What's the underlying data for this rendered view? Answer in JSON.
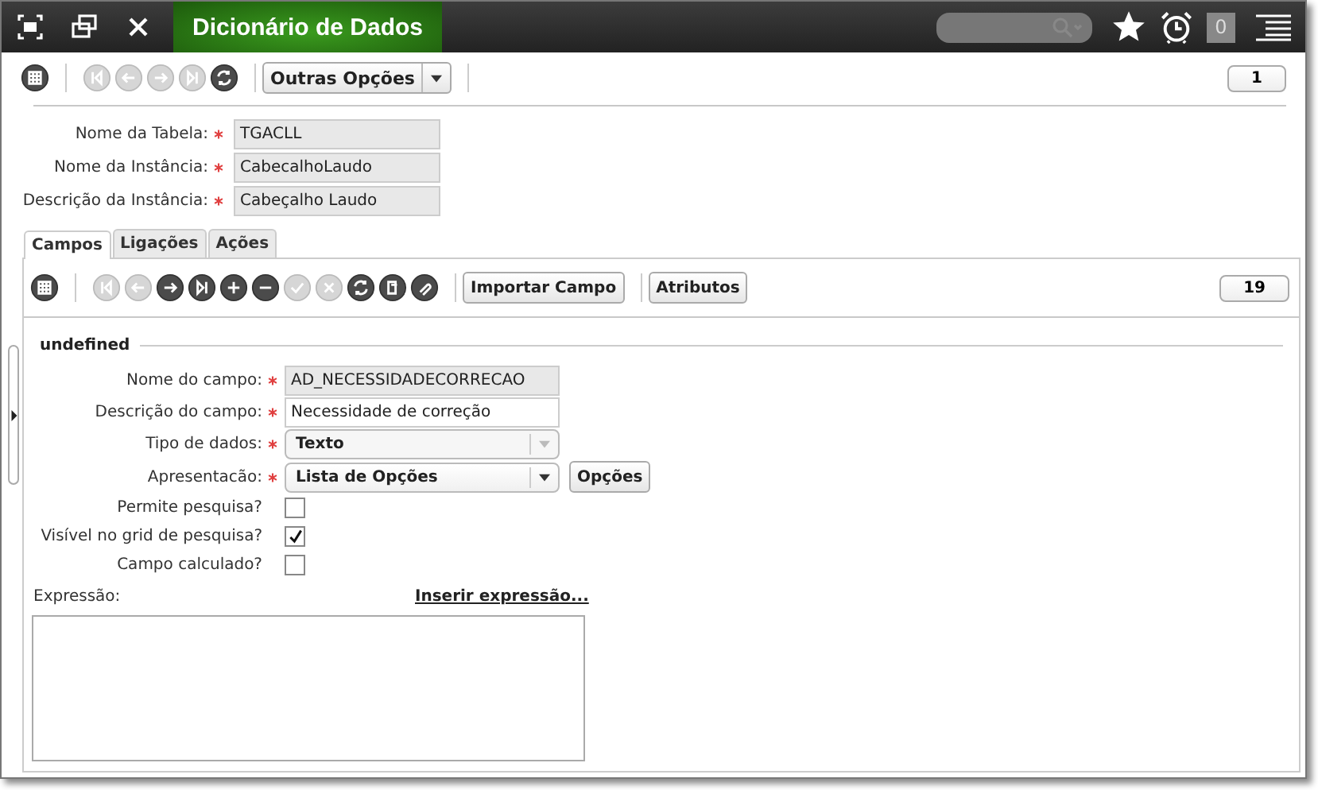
{
  "window": {
    "title": "Dicionário de Dados",
    "notification_count": "0"
  },
  "toolbar": {
    "icons": [
      {
        "kind": "grid",
        "disabled": false
      },
      {
        "kind": "first",
        "disabled": true
      },
      {
        "kind": "prev",
        "disabled": true
      },
      {
        "kind": "next",
        "disabled": true
      },
      {
        "kind": "last",
        "disabled": true
      },
      {
        "kind": "refresh",
        "disabled": false
      }
    ],
    "menu_button": "Outras Opções",
    "record_count": "1"
  },
  "header_fields": [
    {
      "label": "Nome da Tabela:",
      "value": "TGACLL",
      "required": true
    },
    {
      "label": "Nome da Instância:",
      "value": "CabecalhoLaudo",
      "required": true
    },
    {
      "label": "Descrição da Instância:",
      "value": "Cabeçalho Laudo",
      "required": true
    }
  ],
  "tabs": [
    {
      "label": "Campos",
      "selected": true
    },
    {
      "label": "Ligações",
      "selected": false
    },
    {
      "label": "Ações",
      "selected": false
    }
  ],
  "panel_toolbar": {
    "icons": [
      {
        "kind": "grid",
        "disabled": false
      },
      {
        "kind": "first",
        "disabled": true
      },
      {
        "kind": "prev",
        "disabled": true
      },
      {
        "kind": "next",
        "disabled": false
      },
      {
        "kind": "last",
        "disabled": false
      },
      {
        "kind": "add",
        "disabled": false
      },
      {
        "kind": "remove",
        "disabled": false
      },
      {
        "kind": "confirm",
        "disabled": true
      },
      {
        "kind": "cancel",
        "disabled": true
      },
      {
        "kind": "refresh",
        "disabled": false
      },
      {
        "kind": "copy",
        "disabled": false
      },
      {
        "kind": "attach",
        "disabled": false
      }
    ],
    "buttons": [
      "Importar Campo",
      "Atributos"
    ],
    "record_count": "19"
  },
  "section_title": "undefined",
  "fields": [
    {
      "kind": "text",
      "label": "Nome do campo:",
      "required": true,
      "value": "AD_NECESSIDADECORRECAO",
      "disabled": true
    },
    {
      "kind": "text",
      "label": "Descrição do campo:",
      "required": true,
      "value": "Necessidade de correção",
      "disabled": false
    },
    {
      "kind": "select",
      "label": "Tipo de dados:",
      "required": true,
      "value": "Texto",
      "disabled": true
    },
    {
      "kind": "select",
      "label": "Apresentacão:",
      "required": true,
      "value": "Lista de Opções",
      "disabled": false,
      "button": "Opções"
    },
    {
      "kind": "checkbox",
      "label": "Permite pesquisa?",
      "checked": false
    },
    {
      "kind": "checkbox",
      "label": "Visível no grid de pesquisa?",
      "checked": true
    },
    {
      "kind": "checkbox",
      "label": "Campo calculado?",
      "checked": false
    }
  ],
  "expression": {
    "label": "Expressão:",
    "link": "Inserir expressão..."
  }
}
